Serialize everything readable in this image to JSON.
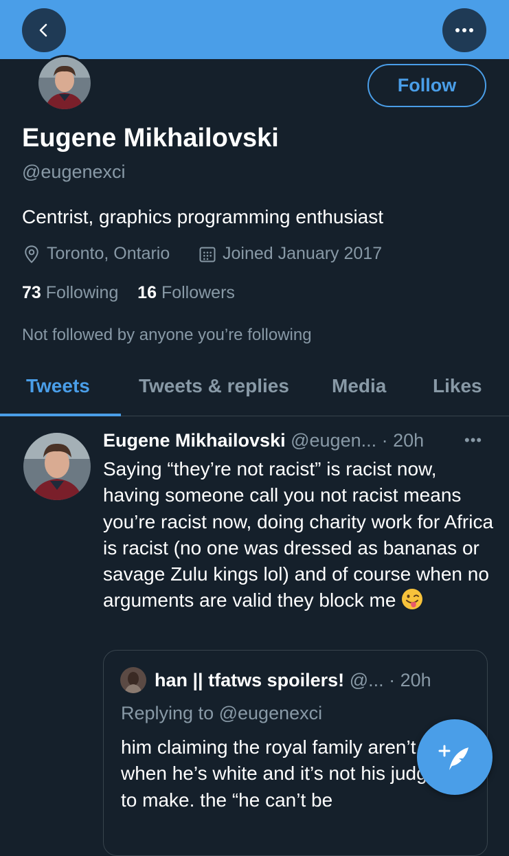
{
  "header": {
    "back_icon": "chevron-left-icon",
    "more_icon": "more-horizontal-icon",
    "follow_label": "Follow"
  },
  "profile": {
    "name": "Eugene Mikhailovski",
    "handle": "@eugenexci",
    "bio": "Centrist, graphics programming enthusiast",
    "location": "Toronto, Ontario",
    "joined": "Joined January 2017",
    "following_count": "73",
    "following_label": "Following",
    "followers_count": "16",
    "followers_label": "Followers",
    "not_followed": "Not followed by anyone you’re following"
  },
  "tabs": [
    {
      "label": "Tweets",
      "active": true
    },
    {
      "label": "Tweets & replies",
      "active": false
    },
    {
      "label": "Media",
      "active": false
    },
    {
      "label": "Likes",
      "active": false
    }
  ],
  "tweet": {
    "name": "Eugene Mikhailovski",
    "handle": "@eugen...",
    "time": "· 20h",
    "more": "•••",
    "text": "Saying “they’re not racist” is racist now, having someone call you not racist means you’re racist now, doing charity work for Africa is racist (no one was dressed as bananas or savage Zulu kings lol) and of course when no arguments are valid they block me",
    "emoji": "tongue-out-face-emoji"
  },
  "quote": {
    "name": "han || tfatws spoilers!",
    "handle": "@...",
    "time": "· 20h",
    "replying_prefix": "Replying to",
    "replying_to": "@eugenexci",
    "text": "him claiming the royal family aren’t racist when he’s white and it’s not his judgment to make. the “he can’t be"
  },
  "fab": {
    "icon": "compose-tweet-icon"
  },
  "colors": {
    "accent": "#4a9ee8",
    "background": "#15202b",
    "secondary_text": "#8899a6",
    "divider": "#38444d"
  }
}
